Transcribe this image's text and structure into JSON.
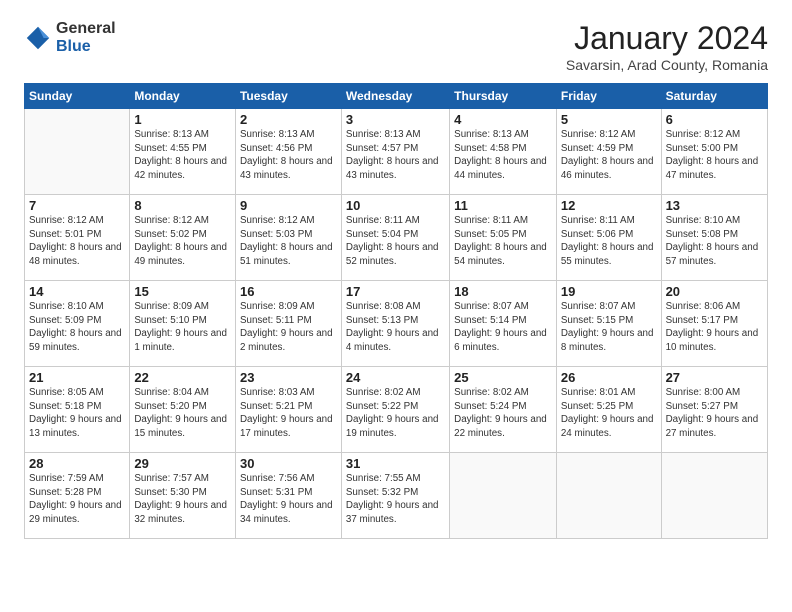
{
  "logo": {
    "general": "General",
    "blue": "Blue"
  },
  "header": {
    "month": "January 2024",
    "location": "Savarsin, Arad County, Romania"
  },
  "weekdays": [
    "Sunday",
    "Monday",
    "Tuesday",
    "Wednesday",
    "Thursday",
    "Friday",
    "Saturday"
  ],
  "weeks": [
    [
      {
        "day": "",
        "sunrise": "",
        "sunset": "",
        "daylight": ""
      },
      {
        "day": "1",
        "sunrise": "Sunrise: 8:13 AM",
        "sunset": "Sunset: 4:55 PM",
        "daylight": "Daylight: 8 hours and 42 minutes."
      },
      {
        "day": "2",
        "sunrise": "Sunrise: 8:13 AM",
        "sunset": "Sunset: 4:56 PM",
        "daylight": "Daylight: 8 hours and 43 minutes."
      },
      {
        "day": "3",
        "sunrise": "Sunrise: 8:13 AM",
        "sunset": "Sunset: 4:57 PM",
        "daylight": "Daylight: 8 hours and 43 minutes."
      },
      {
        "day": "4",
        "sunrise": "Sunrise: 8:13 AM",
        "sunset": "Sunset: 4:58 PM",
        "daylight": "Daylight: 8 hours and 44 minutes."
      },
      {
        "day": "5",
        "sunrise": "Sunrise: 8:12 AM",
        "sunset": "Sunset: 4:59 PM",
        "daylight": "Daylight: 8 hours and 46 minutes."
      },
      {
        "day": "6",
        "sunrise": "Sunrise: 8:12 AM",
        "sunset": "Sunset: 5:00 PM",
        "daylight": "Daylight: 8 hours and 47 minutes."
      }
    ],
    [
      {
        "day": "7",
        "sunrise": "Sunrise: 8:12 AM",
        "sunset": "Sunset: 5:01 PM",
        "daylight": "Daylight: 8 hours and 48 minutes."
      },
      {
        "day": "8",
        "sunrise": "Sunrise: 8:12 AM",
        "sunset": "Sunset: 5:02 PM",
        "daylight": "Daylight: 8 hours and 49 minutes."
      },
      {
        "day": "9",
        "sunrise": "Sunrise: 8:12 AM",
        "sunset": "Sunset: 5:03 PM",
        "daylight": "Daylight: 8 hours and 51 minutes."
      },
      {
        "day": "10",
        "sunrise": "Sunrise: 8:11 AM",
        "sunset": "Sunset: 5:04 PM",
        "daylight": "Daylight: 8 hours and 52 minutes."
      },
      {
        "day": "11",
        "sunrise": "Sunrise: 8:11 AM",
        "sunset": "Sunset: 5:05 PM",
        "daylight": "Daylight: 8 hours and 54 minutes."
      },
      {
        "day": "12",
        "sunrise": "Sunrise: 8:11 AM",
        "sunset": "Sunset: 5:06 PM",
        "daylight": "Daylight: 8 hours and 55 minutes."
      },
      {
        "day": "13",
        "sunrise": "Sunrise: 8:10 AM",
        "sunset": "Sunset: 5:08 PM",
        "daylight": "Daylight: 8 hours and 57 minutes."
      }
    ],
    [
      {
        "day": "14",
        "sunrise": "Sunrise: 8:10 AM",
        "sunset": "Sunset: 5:09 PM",
        "daylight": "Daylight: 8 hours and 59 minutes."
      },
      {
        "day": "15",
        "sunrise": "Sunrise: 8:09 AM",
        "sunset": "Sunset: 5:10 PM",
        "daylight": "Daylight: 9 hours and 1 minute."
      },
      {
        "day": "16",
        "sunrise": "Sunrise: 8:09 AM",
        "sunset": "Sunset: 5:11 PM",
        "daylight": "Daylight: 9 hours and 2 minutes."
      },
      {
        "day": "17",
        "sunrise": "Sunrise: 8:08 AM",
        "sunset": "Sunset: 5:13 PM",
        "daylight": "Daylight: 9 hours and 4 minutes."
      },
      {
        "day": "18",
        "sunrise": "Sunrise: 8:07 AM",
        "sunset": "Sunset: 5:14 PM",
        "daylight": "Daylight: 9 hours and 6 minutes."
      },
      {
        "day": "19",
        "sunrise": "Sunrise: 8:07 AM",
        "sunset": "Sunset: 5:15 PM",
        "daylight": "Daylight: 9 hours and 8 minutes."
      },
      {
        "day": "20",
        "sunrise": "Sunrise: 8:06 AM",
        "sunset": "Sunset: 5:17 PM",
        "daylight": "Daylight: 9 hours and 10 minutes."
      }
    ],
    [
      {
        "day": "21",
        "sunrise": "Sunrise: 8:05 AM",
        "sunset": "Sunset: 5:18 PM",
        "daylight": "Daylight: 9 hours and 13 minutes."
      },
      {
        "day": "22",
        "sunrise": "Sunrise: 8:04 AM",
        "sunset": "Sunset: 5:20 PM",
        "daylight": "Daylight: 9 hours and 15 minutes."
      },
      {
        "day": "23",
        "sunrise": "Sunrise: 8:03 AM",
        "sunset": "Sunset: 5:21 PM",
        "daylight": "Daylight: 9 hours and 17 minutes."
      },
      {
        "day": "24",
        "sunrise": "Sunrise: 8:02 AM",
        "sunset": "Sunset: 5:22 PM",
        "daylight": "Daylight: 9 hours and 19 minutes."
      },
      {
        "day": "25",
        "sunrise": "Sunrise: 8:02 AM",
        "sunset": "Sunset: 5:24 PM",
        "daylight": "Daylight: 9 hours and 22 minutes."
      },
      {
        "day": "26",
        "sunrise": "Sunrise: 8:01 AM",
        "sunset": "Sunset: 5:25 PM",
        "daylight": "Daylight: 9 hours and 24 minutes."
      },
      {
        "day": "27",
        "sunrise": "Sunrise: 8:00 AM",
        "sunset": "Sunset: 5:27 PM",
        "daylight": "Daylight: 9 hours and 27 minutes."
      }
    ],
    [
      {
        "day": "28",
        "sunrise": "Sunrise: 7:59 AM",
        "sunset": "Sunset: 5:28 PM",
        "daylight": "Daylight: 9 hours and 29 minutes."
      },
      {
        "day": "29",
        "sunrise": "Sunrise: 7:57 AM",
        "sunset": "Sunset: 5:30 PM",
        "daylight": "Daylight: 9 hours and 32 minutes."
      },
      {
        "day": "30",
        "sunrise": "Sunrise: 7:56 AM",
        "sunset": "Sunset: 5:31 PM",
        "daylight": "Daylight: 9 hours and 34 minutes."
      },
      {
        "day": "31",
        "sunrise": "Sunrise: 7:55 AM",
        "sunset": "Sunset: 5:32 PM",
        "daylight": "Daylight: 9 hours and 37 minutes."
      },
      {
        "day": "",
        "sunrise": "",
        "sunset": "",
        "daylight": ""
      },
      {
        "day": "",
        "sunrise": "",
        "sunset": "",
        "daylight": ""
      },
      {
        "day": "",
        "sunrise": "",
        "sunset": "",
        "daylight": ""
      }
    ]
  ]
}
